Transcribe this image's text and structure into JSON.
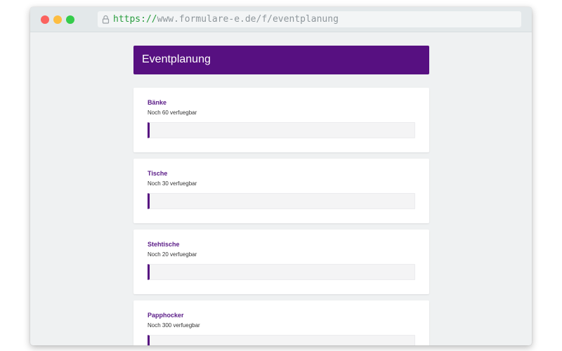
{
  "browser": {
    "url_scheme": "https://",
    "url_rest": "www.formulare-e.de/f/eventplanung",
    "traffic_lights": {
      "close": "#fb625e",
      "minimize": "#fdbd41",
      "maximize": "#35cc4b"
    }
  },
  "form": {
    "title": "Eventplanung",
    "accent_color": "#571081",
    "fields": [
      {
        "label": "Bänke",
        "hint": "Noch 60 verfuegbar",
        "value": ""
      },
      {
        "label": "Tische",
        "hint": "Noch 30 verfuegbar",
        "value": ""
      },
      {
        "label": "Stehtische",
        "hint": "Noch 20 verfuegbar",
        "value": ""
      },
      {
        "label": "Papphocker",
        "hint": "Noch 300 verfuegbar",
        "value": ""
      }
    ]
  }
}
